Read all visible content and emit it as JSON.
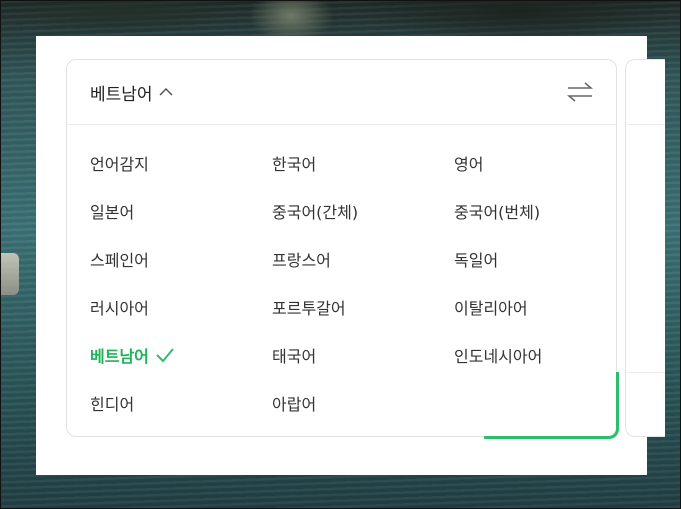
{
  "translator": {
    "source_language": "베트남어",
    "languages": [
      {
        "label": "언어감지",
        "selected": false
      },
      {
        "label": "한국어",
        "selected": false
      },
      {
        "label": "영어",
        "selected": false
      },
      {
        "label": "일본어",
        "selected": false
      },
      {
        "label": "중국어(간체)",
        "selected": false
      },
      {
        "label": "중국어(번체)",
        "selected": false
      },
      {
        "label": "스페인어",
        "selected": false
      },
      {
        "label": "프랑스어",
        "selected": false
      },
      {
        "label": "독일어",
        "selected": false
      },
      {
        "label": "러시아어",
        "selected": false
      },
      {
        "label": "포르투갈어",
        "selected": false
      },
      {
        "label": "이탈리아어",
        "selected": false
      },
      {
        "label": "베트남어",
        "selected": true
      },
      {
        "label": "태국어",
        "selected": false
      },
      {
        "label": "인도네시아어",
        "selected": false
      },
      {
        "label": "힌디어",
        "selected": false
      },
      {
        "label": "아랍어",
        "selected": false
      }
    ]
  },
  "icons": {
    "caret": "chevron-up-icon",
    "swap": "swap-arrows-icon",
    "check": "check-icon"
  },
  "colors": {
    "accent": "#2dbe6c",
    "selected_text": "#1fb45a"
  }
}
